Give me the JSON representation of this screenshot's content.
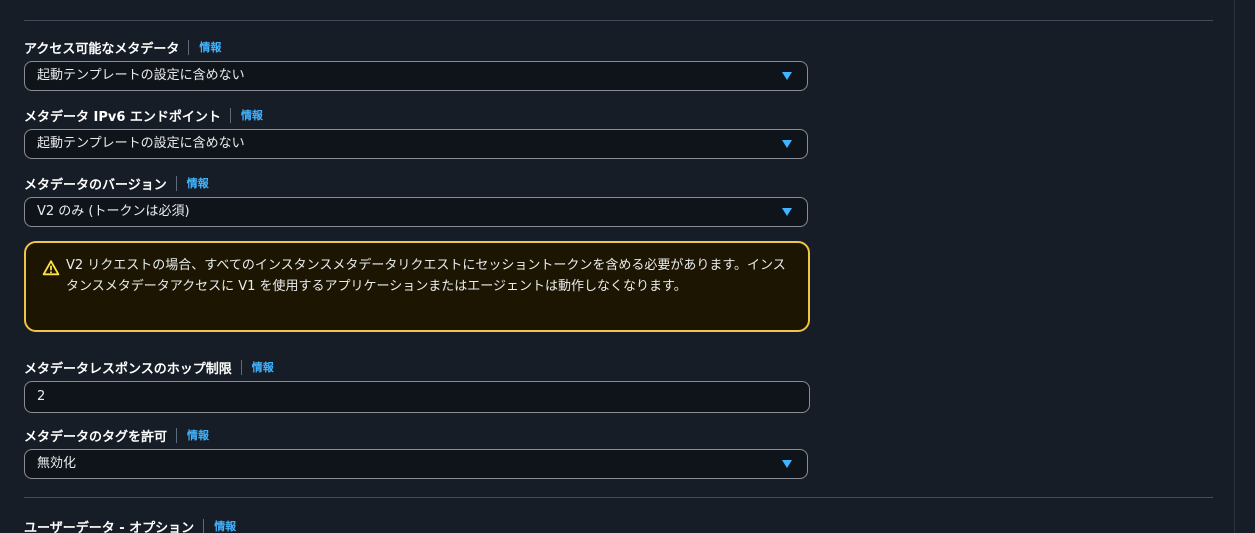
{
  "fields": {
    "accessible_metadata": {
      "label": "アクセス可能なメタデータ",
      "info": "情報",
      "value": "起動テンプレートの設定に含めない"
    },
    "metadata_ipv6_endpoint": {
      "label": "メタデータ IPv6 エンドポイント",
      "info": "情報",
      "value": "起動テンプレートの設定に含めない"
    },
    "metadata_version": {
      "label": "メタデータのバージョン",
      "info": "情報",
      "value": "V2 のみ (トークンは必須)"
    },
    "hop_limit": {
      "label": "メタデータレスポンスのホップ制限",
      "info": "情報",
      "value": "2"
    },
    "allow_tags": {
      "label": "メタデータのタグを許可",
      "info": "情報",
      "value": "無効化"
    },
    "user_data": {
      "label": "ユーザーデータ - オプション",
      "info": "情報"
    }
  },
  "alert": {
    "icon": "warning-icon",
    "text": "V2 リクエストの場合、すべてのインスタンスメタデータリクエストにセッショントークンを含める必要があります。インスタンスメタデータアクセスに V1 を使用するアプリケーションまたはエージェントは動作しなくなります。"
  },
  "colors": {
    "background": "#161d26",
    "link": "#42b4ff",
    "warning_border": "#f0c445",
    "input_border": "#8c8c94"
  }
}
